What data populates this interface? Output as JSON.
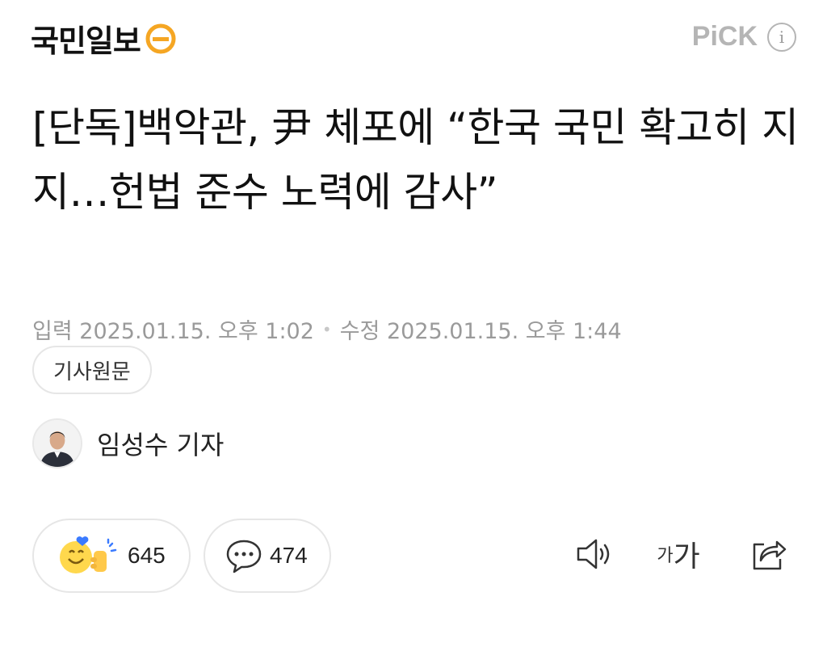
{
  "header": {
    "logo_text": "국민일보",
    "pick_label": "PiCK",
    "info_symbol": "i"
  },
  "article": {
    "headline": "[단독]백악관, 尹 체포에 “한국 국민 확고히 지지…헌법 준수 노력에 감사”",
    "published": "입력 2025.01.15. 오후 1:02",
    "modified": "수정 2025.01.15. 오후 1:44",
    "original_button": "기사원문",
    "reporter": "임성수 기자"
  },
  "actions": {
    "reaction_count": "645",
    "comment_count": "474",
    "font_small": "가",
    "font_big": "가"
  },
  "colors": {
    "logo_accent": "#f5a623",
    "muted": "#9a9a9a",
    "border": "#e6e6e6"
  }
}
